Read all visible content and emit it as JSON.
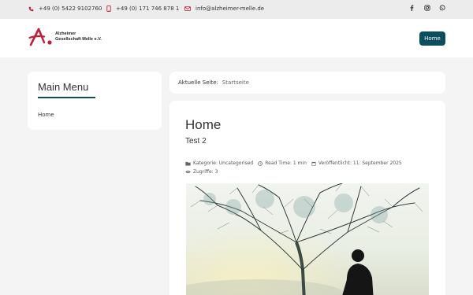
{
  "topbar": {
    "phone1": "+49 (0) 5422 9102760",
    "phone2": "+49 (0) 171 746 878 1",
    "email": "info@alzheimer-melle.de",
    "phone1_icon": "phone-icon",
    "phone2_icon": "mobile-icon",
    "email_icon": "envelope-icon",
    "social_icons": [
      "facebook-icon",
      "instagram-icon",
      "whatsapp-icon"
    ],
    "icon_color": "#c0203a"
  },
  "header": {
    "logo_line1": "Alzheimer",
    "logo_line2": "Gesellschaft Melle e.V.",
    "logo_accent": "#c0203a",
    "nav_home": "Home",
    "accent": "#0c4d5e"
  },
  "sidebar": {
    "title": "Main Menu",
    "items": [
      {
        "label": "Home"
      }
    ]
  },
  "breadcrumb": {
    "label": "Aktuelle Seite:",
    "current": "Startseite"
  },
  "article": {
    "title": "Home",
    "subtitle": "Test 2",
    "category": "Kategorie: Uncategorised",
    "read_time": "Read Time: 1 min",
    "published": "Veröffentlicht: 11. September 2025",
    "hits": "Zugriffe: 3"
  }
}
